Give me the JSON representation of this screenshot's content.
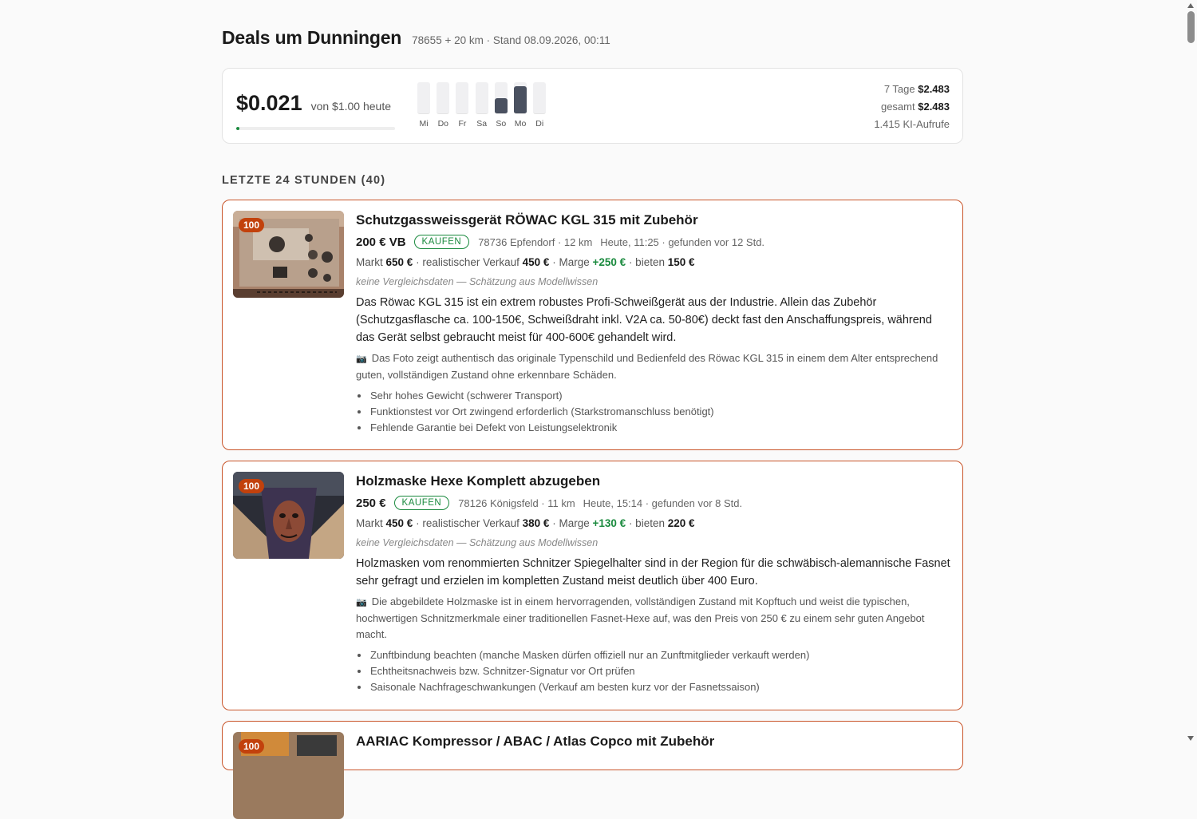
{
  "header": {
    "title": "Deals um Dunningen",
    "subtitle": "78655 + 20 km · Stand 08.09.2026, 00:11"
  },
  "stats": {
    "cost_today": "$0.021",
    "budget_label": "von $1.00 heute",
    "budget_fraction": 0.021,
    "days": [
      {
        "label": "Mi",
        "level": 0
      },
      {
        "label": "Do",
        "level": 0
      },
      {
        "label": "Fr",
        "level": 0
      },
      {
        "label": "Sa",
        "level": 0
      },
      {
        "label": "So",
        "level": 0.5
      },
      {
        "label": "Mo",
        "level": 0.88
      },
      {
        "label": "Di",
        "level": 0
      }
    ],
    "week_label": "7 Tage",
    "week_value": "$2.483",
    "total_label": "gesamt",
    "total_value": "$2.483",
    "calls": "1.415 KI-Aufrufe"
  },
  "section": {
    "title": "LETZTE 24 STUNDEN (40)"
  },
  "deals": [
    {
      "score": "100",
      "title": "Schutzgassweissgerät RÖWAC KGL 315 mit Zubehör",
      "price": "200 € VB",
      "badge": "KAUFEN",
      "location": "78736 Epfendorf · 12 km",
      "time": "Heute, 11:25 · gefunden vor 12 Std.",
      "market_label": "Markt",
      "market": "650 €",
      "realistic_label": "· realistischer Verkauf",
      "realistic": "450 €",
      "margin_label": "· Marge",
      "margin": "+250 €",
      "offer_label": "· bieten",
      "offer": "150 €",
      "note": "keine Vergleichsdaten — Schätzung aus Modellwissen",
      "description": "Das Röwac KGL 315 ist ein extrem robustes Profi-Schweißgerät aus der Industrie. Allein das Zubehör (Schutzgasflasche ca. 100-150€, Schweißdraht inkl. V2A ca. 50-80€) deckt fast den Anschaffungspreis, während das Gerät selbst gebraucht meist für 400-600€ gehandelt wird.",
      "photo_note": "Das Foto zeigt authentisch das originale Typenschild und Bedienfeld des Röwac KGL 315 in einem dem Alter entsprechend guten, vollständigen Zustand ohne erkennbare Schäden.",
      "risks": [
        "Sehr hohes Gewicht (schwerer Transport)",
        "Funktionstest vor Ort zwingend erforderlich (Starkstromanschluss benötigt)",
        "Fehlende Garantie bei Defekt von Leistungselektronik"
      ]
    },
    {
      "score": "100",
      "title": "Holzmaske Hexe Komplett abzugeben",
      "price": "250 €",
      "badge": "KAUFEN",
      "location": "78126 Königsfeld · 11 km",
      "time": "Heute, 15:14 · gefunden vor 8 Std.",
      "market_label": "Markt",
      "market": "450 €",
      "realistic_label": "· realistischer Verkauf",
      "realistic": "380 €",
      "margin_label": "· Marge",
      "margin": "+130 €",
      "offer_label": "· bieten",
      "offer": "220 €",
      "note": "keine Vergleichsdaten — Schätzung aus Modellwissen",
      "description": "Holzmasken vom renommierten Schnitzer Spiegelhalter sind in der Region für die schwäbisch-alemannische Fasnet sehr gefragt und erzielen im kompletten Zustand meist deutlich über 400 Euro.",
      "photo_note": "Die abgebildete Holzmaske ist in einem hervorragenden, vollständigen Zustand mit Kopftuch und weist die typischen, hochwertigen Schnitzmerkmale einer traditionellen Fasnet-Hexe auf, was den Preis von 250 € zu einem sehr guten Angebot macht.",
      "risks": [
        "Zunftbindung beachten (manche Masken dürfen offiziell nur an Zunftmitglieder verkauft werden)",
        "Echtheitsnachweis bzw. Schnitzer-Signatur vor Ort prüfen",
        "Saisonale Nachfrageschwankungen (Verkauf am besten kurz vor der Fasnetssaison)"
      ]
    },
    {
      "score": "100",
      "title": "AARIAC Kompressor / ABAC / Atlas Copco mit Zubehör"
    }
  ]
}
